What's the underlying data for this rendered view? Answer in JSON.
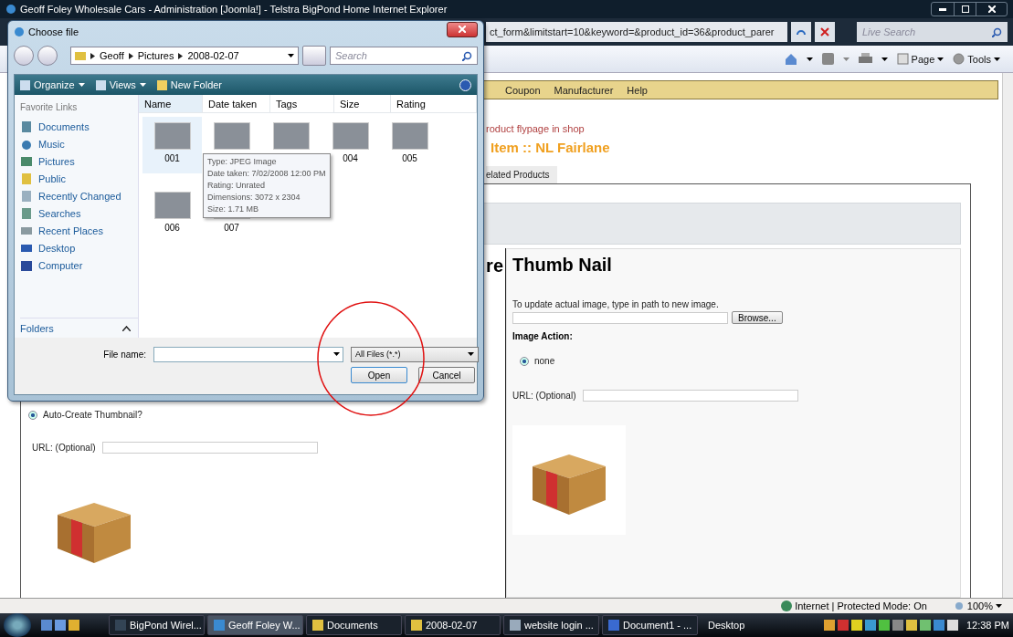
{
  "browser": {
    "title": "Geoff Foley Wholesale Cars - Administration [Joomla!] - Telstra BigPond Home Internet Explorer",
    "address_fragment": "ct_form&limitstart=10&keyword=&product_id=36&product_parer",
    "search_placeholder": "Live Search",
    "command_bar": [
      "Page",
      "Tools"
    ]
  },
  "page": {
    "menu": [
      "Coupon",
      "Manufacturer",
      "Help"
    ],
    "link_fragment": "roduct flypage in shop",
    "heading_fragment": "Item :: NL Fairlane",
    "tab_fragment": "elated Products",
    "left_column": {
      "heading_fragment": "re",
      "radio": {
        "label": "Auto-Create Thumbnail?",
        "selected": true
      },
      "url_label": "URL: (Optional)"
    },
    "right_column": {
      "heading": "Thumb Nail",
      "instruction": "To update actual image, type in path to new image.",
      "browse": "Browse...",
      "image_action": "Image Action:",
      "radio": {
        "label": "none",
        "selected": true
      },
      "url_label": "URL: (Optional)"
    }
  },
  "status_bar": {
    "zone": "Internet | Protected Mode: On",
    "zoom": "100%"
  },
  "taskbar": {
    "buttons": [
      {
        "label": "BigPond Wirel...",
        "selected": false
      },
      {
        "label": "Geoff Foley W...",
        "selected": true
      },
      {
        "label": "Documents",
        "selected": false
      },
      {
        "label": "2008-02-07",
        "selected": false
      },
      {
        "label": "website login ...",
        "selected": false
      },
      {
        "label": "Document1 - ...",
        "selected": false
      }
    ],
    "desktop": "Desktop",
    "clock": "12:38 PM"
  },
  "dialog": {
    "title": "Choose file",
    "breadcrumb": [
      "Geoff",
      "Pictures",
      "2008-02-07"
    ],
    "search_placeholder": "Search",
    "toolbar": [
      "Organize",
      "Views",
      "New Folder"
    ],
    "favorite_links_title": "Favorite Links",
    "links": [
      "Documents",
      "Music",
      "Pictures",
      "Public",
      "Recently Changed",
      "Searches",
      "Recent Places",
      "Desktop",
      "Computer"
    ],
    "folders": "Folders",
    "columns": [
      "Name",
      "Date taken",
      "Tags",
      "Size",
      "Rating"
    ],
    "files": [
      {
        "name": "001",
        "selected": true
      },
      {
        "selected": false
      },
      {
        "selected": false
      },
      {
        "name": "004",
        "selected": false
      },
      {
        "name": "005",
        "selected": false
      },
      {
        "name": "006",
        "selected": false
      },
      {
        "name": "007",
        "selected": false
      }
    ],
    "tooltip": [
      "Type: JPEG Image",
      "Date taken: 7/02/2008 12:00 PM",
      "Rating: Unrated",
      "Dimensions: 3072 x 2304",
      "Size: 1.71 MB"
    ],
    "file_name_label": "File name:",
    "filter": "All Files (*.*)",
    "buttons": [
      "Open",
      "Cancel"
    ]
  }
}
